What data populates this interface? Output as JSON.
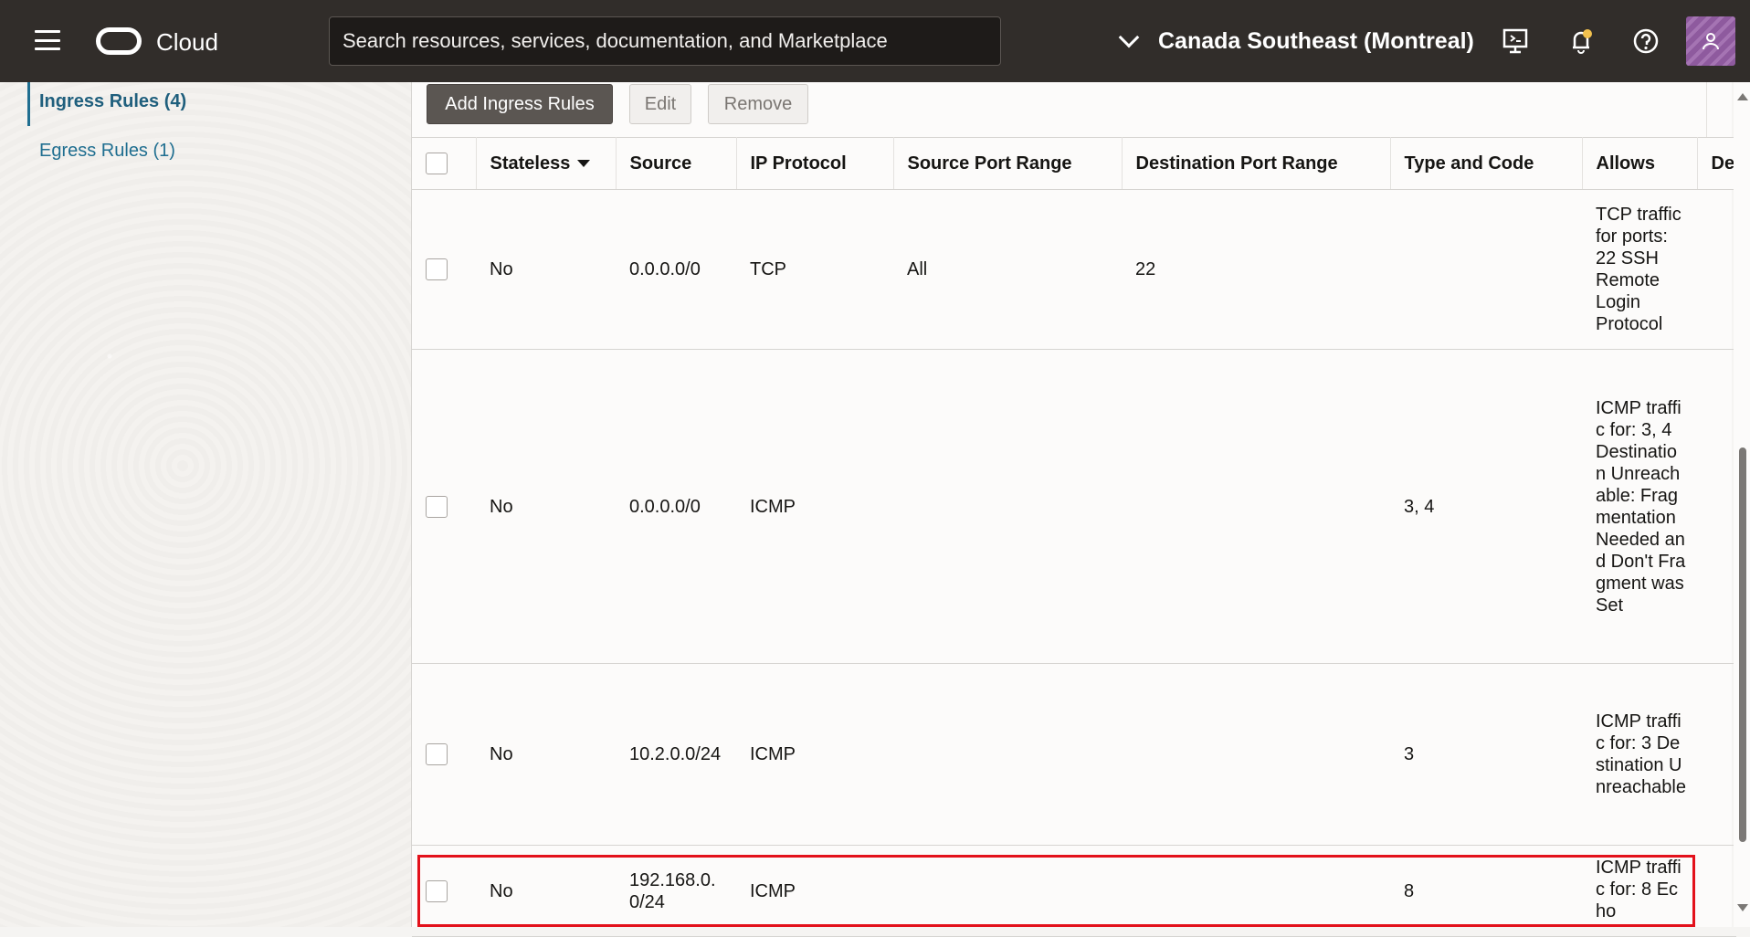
{
  "header": {
    "brand": "Cloud",
    "search_placeholder": "Search resources, services, documentation, and Marketplace",
    "region": "Canada Southeast (Montreal)",
    "icons": [
      "menu-icon",
      "oracle-logo-icon",
      "chevron-down-icon",
      "cloud-shell-icon",
      "bell-icon",
      "help-icon",
      "user-icon"
    ],
    "notification_dot_color": "#f2c14e"
  },
  "sidebar": {
    "items": [
      {
        "label": "Ingress Rules (4)",
        "active": true
      },
      {
        "label": "Egress Rules (1)",
        "active": false
      }
    ]
  },
  "toolbar": {
    "add_label": "Add Ingress Rules",
    "edit_label": "Edit",
    "remove_label": "Remove"
  },
  "table": {
    "columns": [
      "Stateless",
      "Source",
      "IP Protocol",
      "Source Port Range",
      "Destination Port Range",
      "Type and Code",
      "Allows",
      "De"
    ],
    "rows": [
      {
        "stateless": "No",
        "source": "0.0.0.0/0",
        "protocol": "TCP",
        "src_port": "All",
        "dst_port": "22",
        "type_code": "",
        "allows": "TCP traffic for ports: 22 SSH Remote Login Protocol"
      },
      {
        "stateless": "No",
        "source": "0.0.0.0/0",
        "protocol": "ICMP",
        "src_port": "",
        "dst_port": "",
        "type_code": "3, 4",
        "allows": "ICMP traffic for: 3, 4 Destination Unreachable: Fragmentation Needed and Don't Fragment was Set"
      },
      {
        "stateless": "No",
        "source": "10.2.0.0/24",
        "protocol": "ICMP",
        "src_port": "",
        "dst_port": "",
        "type_code": "3",
        "allows": "ICMP traffic for: 3 Destination Unreachable"
      },
      {
        "stateless": "No",
        "source": "192.168.0.0/24",
        "protocol": "ICMP",
        "src_port": "",
        "dst_port": "",
        "type_code": "8",
        "allows": "ICMP traffic for: 8 Echo"
      }
    ]
  },
  "colors": {
    "header_bg": "#312d2a",
    "link": "#1f6e90",
    "highlight": "#e3111b"
  }
}
